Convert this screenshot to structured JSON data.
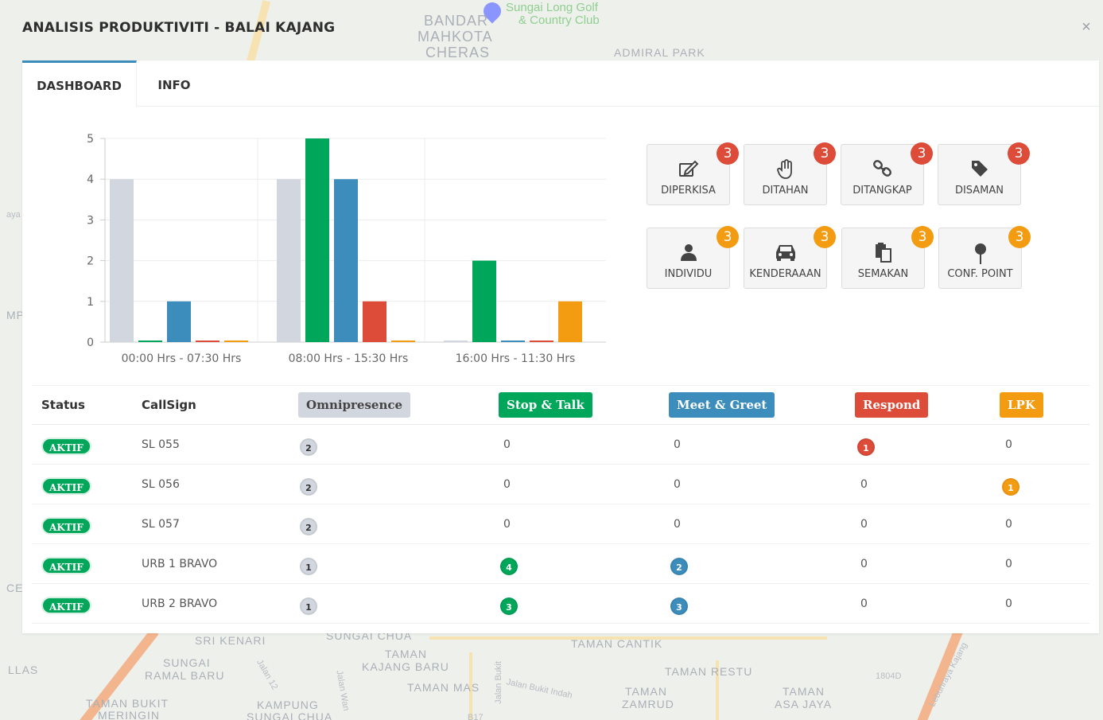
{
  "map": {
    "labels": [
      "BANDAR",
      "MAHKOTA",
      "CHERAS",
      "ADMIRAL PARK",
      "SRI KENARI",
      "SUNGAI CHUA",
      "TAMAN",
      "KAJANG BARU",
      "TAMAN MAS",
      "TAMAN CANTIK",
      "TAMAN RESTU",
      "TAMAN",
      "ZAMRUD",
      "TAMAN",
      "ASA JAYA",
      "SUNGAI",
      "RAMAL BARU",
      "TAMAN BUKIT",
      "MERINGIN",
      "KAMPUNG",
      "SUNGAI CHUA",
      "LLAS",
      "CE",
      "MP",
      "aya"
    ],
    "green_labels": [
      "Sungai Long Golf",
      "& Country Club"
    ],
    "road_labels": [
      "Jalan Bukit Indah",
      "Jalan Bukit",
      "Jalan 12",
      "Jalan Wan",
      "Lebuhraya Kajang",
      "B17",
      "1804D"
    ]
  },
  "header": {
    "title": "ANALISIS PRODUKTIVITI - BALAI KAJANG",
    "close_icon": "close-icon"
  },
  "tabs": [
    {
      "label": "DASHBOARD",
      "active": true
    },
    {
      "label": "INFO",
      "active": false
    }
  ],
  "chart_data": {
    "type": "bar",
    "categories": [
      "00:00 Hrs - 07:30 Hrs",
      "08:00 Hrs - 15:30 Hrs",
      "16:00 Hrs - 11:30 Hrs"
    ],
    "series": [
      {
        "name": "Omnipresence",
        "color": "#d2d6de",
        "values": [
          4,
          4,
          0
        ]
      },
      {
        "name": "Stop & Talk",
        "color": "#00a65a",
        "values": [
          0,
          5,
          2
        ]
      },
      {
        "name": "Meet & Greet",
        "color": "#3c8dbc",
        "values": [
          1,
          4,
          0
        ]
      },
      {
        "name": "Respond",
        "color": "#dd4b39",
        "values": [
          0,
          1,
          0
        ]
      },
      {
        "name": "LPK",
        "color": "#f39c12",
        "values": [
          0,
          0,
          1
        ]
      }
    ],
    "ylim": [
      0,
      5
    ],
    "yticks": [
      0,
      1,
      2,
      3,
      4,
      5
    ],
    "grid": true,
    "legend": "none"
  },
  "actions": [
    {
      "label": "DIPERKISA",
      "icon": "edit-icon",
      "count": "3",
      "badge_color": "#dd4b39"
    },
    {
      "label": "DITAHAN",
      "icon": "hand-icon",
      "count": "3",
      "badge_color": "#dd4b39"
    },
    {
      "label": "DITANGKAP",
      "icon": "link-icon",
      "count": "3",
      "badge_color": "#dd4b39"
    },
    {
      "label": "DISAMAN",
      "icon": "tag-icon",
      "count": "3",
      "badge_color": "#dd4b39"
    },
    {
      "label": "INDIVIDU",
      "icon": "user-icon",
      "count": "3",
      "badge_color": "#f39c12"
    },
    {
      "label": "KENDERAAAN",
      "icon": "car-icon",
      "count": "3",
      "badge_color": "#f39c12"
    },
    {
      "label": "SEMAKAN",
      "icon": "clipboard-icon",
      "count": "3",
      "badge_color": "#f39c12"
    },
    {
      "label": "CONF. POINT",
      "icon": "map-pin-icon",
      "count": "3",
      "badge_color": "#f39c12"
    }
  ],
  "table": {
    "headers": {
      "status": "Status",
      "callsign": "CallSign",
      "omnipresence": "Omnipresence",
      "stop_talk": "Stop & Talk",
      "meet_greet": "Meet & Greet",
      "respond": "Respond",
      "lpk": "LPK"
    },
    "header_colors": {
      "omnipresence": "#d2d6de",
      "stop_talk": "#00a65a",
      "meet_greet": "#3c8dbc",
      "respond": "#dd4b39",
      "lpk": "#f39c12"
    },
    "rows": [
      {
        "status": "AKTIF",
        "callsign": "SL 055",
        "omnipresence": "2",
        "stop_talk": "0",
        "meet_greet": "0",
        "respond": "1",
        "lpk": "0"
      },
      {
        "status": "AKTIF",
        "callsign": "SL 056",
        "omnipresence": "2",
        "stop_talk": "0",
        "meet_greet": "0",
        "respond": "0",
        "lpk": "1"
      },
      {
        "status": "AKTIF",
        "callsign": "SL 057",
        "omnipresence": "2",
        "stop_talk": "0",
        "meet_greet": "0",
        "respond": "0",
        "lpk": "0"
      },
      {
        "status": "AKTIF",
        "callsign": "URB 1 BRAVO",
        "omnipresence": "1",
        "stop_talk": "4",
        "meet_greet": "2",
        "respond": "0",
        "lpk": "0"
      },
      {
        "status": "AKTIF",
        "callsign": "URB 2 BRAVO",
        "omnipresence": "1",
        "stop_talk": "3",
        "meet_greet": "3",
        "respond": "0",
        "lpk": "0"
      }
    ]
  }
}
